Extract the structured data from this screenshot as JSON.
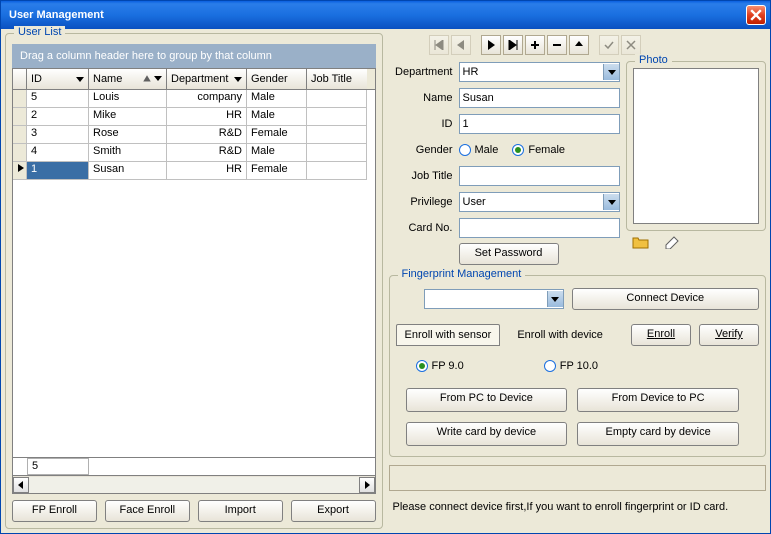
{
  "window": {
    "title": "User Management"
  },
  "userlist": {
    "legend": "User List",
    "group_hint": "Drag a column header here to group by that column",
    "columns": {
      "id": "ID",
      "name": "Name",
      "department": "Department",
      "gender": "Gender",
      "job_title": "Job Title"
    },
    "rows": [
      {
        "id": "5",
        "name": "Louis",
        "department": "company",
        "gender": "Male",
        "job_title": ""
      },
      {
        "id": "2",
        "name": "Mike",
        "department": "HR",
        "gender": "Male",
        "job_title": ""
      },
      {
        "id": "3",
        "name": "Rose",
        "department": "R&D",
        "gender": "Female",
        "job_title": ""
      },
      {
        "id": "4",
        "name": "Smith",
        "department": "R&D",
        "gender": "Male",
        "job_title": ""
      },
      {
        "id": "1",
        "name": "Susan",
        "department": "HR",
        "gender": "Female",
        "job_title": ""
      }
    ],
    "footer_count": "5",
    "selected_index": 4
  },
  "buttons": {
    "fp_enroll": "FP Enroll",
    "face_enroll": "Face Enroll",
    "import": "Import",
    "export": "Export"
  },
  "form": {
    "labels": {
      "department": "Department",
      "name": "Name",
      "id": "ID",
      "gender": "Gender",
      "job_title": "Job Title",
      "privilege": "Privilege",
      "card_no": "Card No."
    },
    "values": {
      "department": "HR",
      "name": "Susan",
      "id": "1",
      "job_title": "",
      "privilege": "User",
      "card_no": ""
    },
    "gender_options": {
      "male": "Male",
      "female": "Female"
    },
    "gender_selected": "female",
    "set_password": "Set Password"
  },
  "photo": {
    "legend": "Photo"
  },
  "fingerprint": {
    "legend": "Fingerprint Management",
    "connect_device": "Connect Device",
    "tab_sensor": "Enroll with sensor",
    "tab_device": "Enroll with device",
    "enroll": "Enroll",
    "verify": "Verify",
    "fp90": "FP 9.0",
    "fp100": "FP 10.0",
    "fp_selected": "fp90",
    "pc_to_device": "From PC to Device",
    "device_to_pc": "From Device to PC",
    "write_card": "Write card by device",
    "empty_card": "Empty card by device"
  },
  "status": {
    "text": "Please connect device first,If you want to enroll fingerprint or ID card."
  }
}
